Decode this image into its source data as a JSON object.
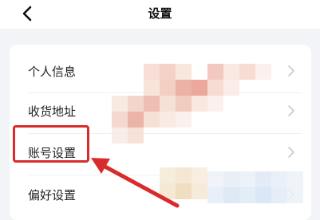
{
  "header": {
    "title": "设置",
    "back_icon": "chevron-left-icon"
  },
  "settings": {
    "items": [
      {
        "label": "个人信息"
      },
      {
        "label": "收货地址"
      },
      {
        "label": "账号设置"
      },
      {
        "label": "偏好设置"
      }
    ],
    "chevron_icon": "chevron-right-icon"
  },
  "annotation": {
    "highlight_color": "#d92b2b",
    "arrow_icon": "arrow-pointer-icon"
  },
  "colors": {
    "background": "#f3f4f7",
    "card": "#ffffff",
    "text": "#222222",
    "chevron": "#c7c9cd"
  }
}
